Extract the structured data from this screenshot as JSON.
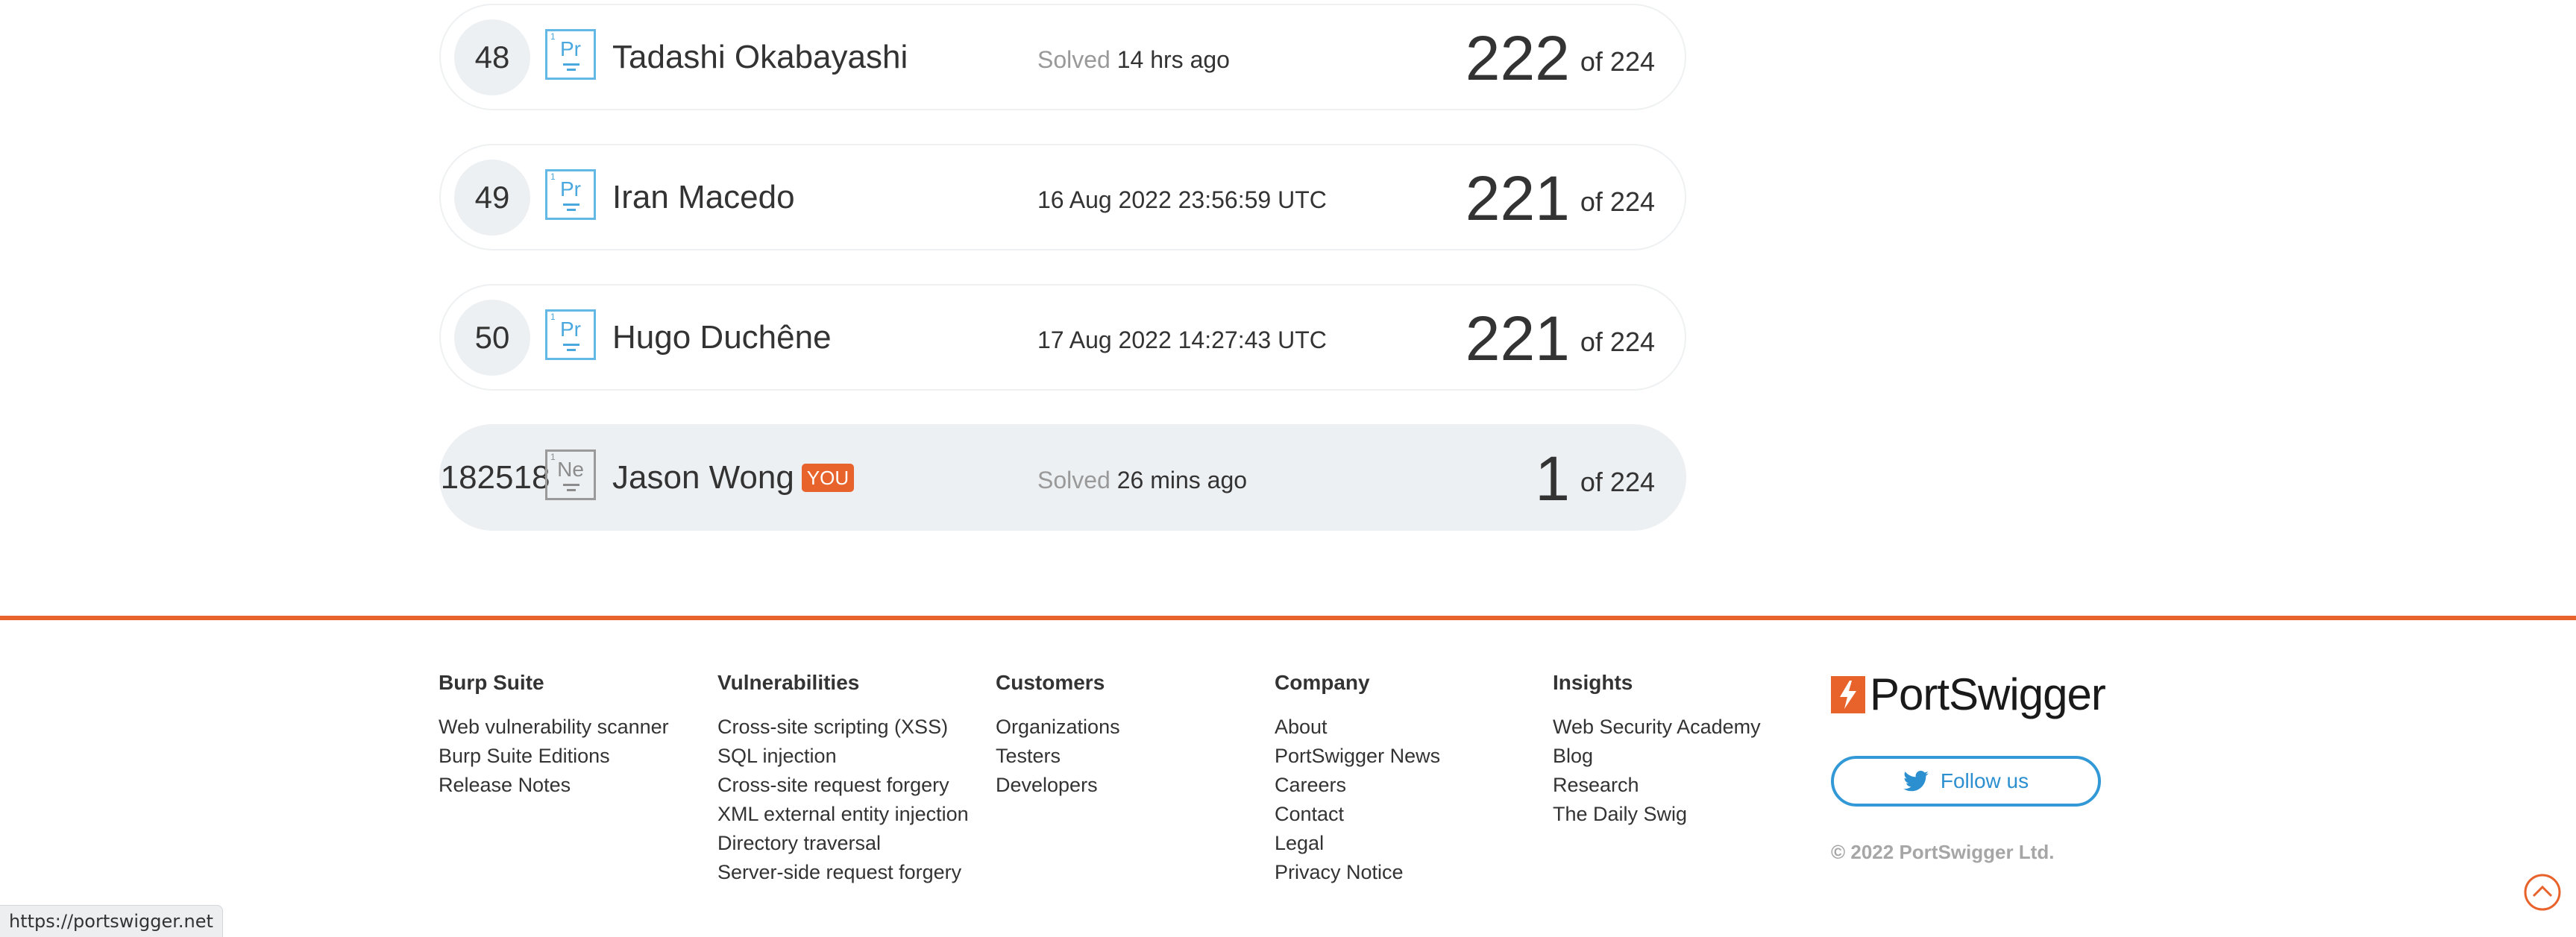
{
  "leaderboard": {
    "rows": [
      {
        "rank": "48",
        "element_number": "1",
        "element_symbol": "Pr",
        "name": "Tadashi Okabayashi",
        "status_label": "Solved",
        "status_value": "14 hrs ago",
        "score": "222",
        "score_total": "of 224"
      },
      {
        "rank": "49",
        "element_number": "1",
        "element_symbol": "Pr",
        "name": "Iran Macedo",
        "status_label": "",
        "status_value": "16 Aug 2022 23:56:59 UTC",
        "score": "221",
        "score_total": "of 224"
      },
      {
        "rank": "50",
        "element_number": "1",
        "element_symbol": "Pr",
        "name": "Hugo Duchêne",
        "status_label": "",
        "status_value": "17 Aug 2022 14:27:43 UTC",
        "score": "221",
        "score_total": "of 224"
      },
      {
        "rank": "182518",
        "element_number": "1",
        "element_symbol": "Ne",
        "name": "Jason Wong",
        "badge": "YOU",
        "status_label": "Solved",
        "status_value": "26 mins ago",
        "score": "1",
        "score_total": "of 224"
      }
    ]
  },
  "footer": {
    "columns": [
      {
        "title": "Burp Suite",
        "links": [
          "Web vulnerability scanner",
          "Burp Suite Editions",
          "Release Notes"
        ]
      },
      {
        "title": "Vulnerabilities",
        "links": [
          "Cross-site scripting (XSS)",
          "SQL injection",
          "Cross-site request forgery",
          "XML external entity injection",
          "Directory traversal",
          "Server-side request forgery"
        ]
      },
      {
        "title": "Customers",
        "links": [
          "Organizations",
          "Testers",
          "Developers"
        ]
      },
      {
        "title": "Company",
        "links": [
          "About",
          "PortSwigger News",
          "Careers",
          "Contact",
          "Legal",
          "Privacy Notice"
        ]
      },
      {
        "title": "Insights",
        "links": [
          "Web Security Academy",
          "Blog",
          "Research",
          "The Daily Swig"
        ]
      }
    ],
    "logo_text": "PortSwigger",
    "follow_label": "Follow us",
    "copyright": "© 2022 PortSwigger Ltd."
  },
  "status_bar": {
    "url": "https://portswigger.net"
  },
  "icons": {
    "logo": "portswigger-logo-icon",
    "follow": "twitter-bird-icon",
    "scroll_top": "scroll-to-top-icon"
  },
  "colors": {
    "accent": "#e8632c",
    "element_border": "#64b8e6",
    "element_neutral": "#9a9a9a",
    "twitter_blue": "#3399d6",
    "row_highlight": "#edf0f2"
  }
}
